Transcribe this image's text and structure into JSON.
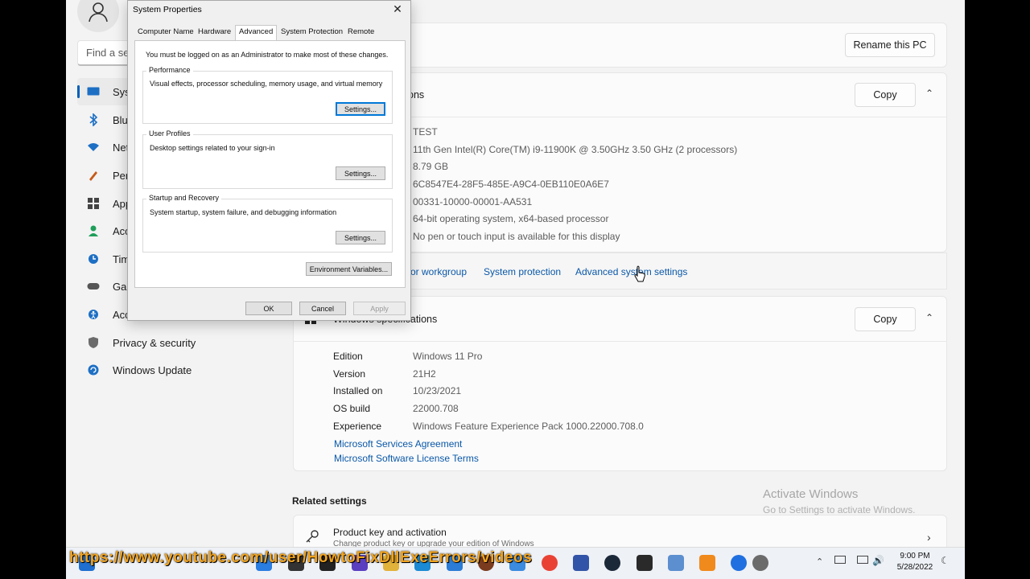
{
  "settings": {
    "search_placeholder": "Find a set",
    "nav": [
      {
        "label": "Syste",
        "icon": "system-icon",
        "active": true
      },
      {
        "label": "Blue",
        "icon": "bluetooth-icon"
      },
      {
        "label": "Netv",
        "icon": "network-icon"
      },
      {
        "label": "Pers",
        "icon": "personalization-icon"
      },
      {
        "label": "App",
        "icon": "apps-icon"
      },
      {
        "label": "Acco",
        "icon": "accounts-icon"
      },
      {
        "label": "Time",
        "icon": "time-icon"
      },
      {
        "label": "Gam",
        "icon": "gaming-icon"
      },
      {
        "label": "Acce",
        "icon": "accessibility-icon"
      },
      {
        "label": "Privacy & security",
        "icon": "shield-icon"
      },
      {
        "label": "Windows Update",
        "icon": "update-icon"
      }
    ],
    "rename_button": "Rename this PC",
    "device_section_title_fragment": "ons",
    "copy_label": "Copy",
    "device_specs": [
      "TEST",
      "11th Gen Intel(R) Core(TM) i9-11900K @ 3.50GHz   3.50 GHz  (2 processors)",
      "8.79 GB",
      "6C8547E4-28F5-485E-A9C4-0EB110E0A6E7",
      "00331-10000-00001-AA531",
      "64-bit operating system, x64-based processor",
      "No pen or touch input is available for this display"
    ],
    "related_links": {
      "domain": "or workgroup",
      "protection": "System protection",
      "advanced": "Advanced system settings"
    },
    "windows_spec_title": "Windows specifications",
    "windows_specs": [
      {
        "key": "Edition",
        "value": "Windows 11 Pro"
      },
      {
        "key": "Version",
        "value": "21H2"
      },
      {
        "key": "Installed on",
        "value": "10/23/2021"
      },
      {
        "key": "OS build",
        "value": "22000.708"
      },
      {
        "key": "Experience",
        "value": "Windows Feature Experience Pack 1000.22000.708.0"
      }
    ],
    "ms_links": [
      "Microsoft Services Agreement",
      "Microsoft Software License Terms"
    ],
    "related_settings_title": "Related settings",
    "product_key_title": "Product key and activation",
    "product_key_sub": "Change product key or upgrade your edition of Windows",
    "activate_title": "Activate Windows",
    "activate_sub": "Go to Settings to activate Windows."
  },
  "dialog": {
    "title": "System Properties",
    "tabs": [
      "Computer Name",
      "Hardware",
      "Advanced",
      "System Protection",
      "Remote"
    ],
    "active_tab": "Advanced",
    "admin_note": "You must be logged on as an Administrator to make most of these changes.",
    "performance_title": "Performance",
    "performance_desc": "Visual effects, processor scheduling, memory usage, and virtual memory",
    "profiles_title": "User Profiles",
    "profiles_desc": "Desktop settings related to your sign-in",
    "startup_title": "Startup and Recovery",
    "startup_desc": "System startup, system failure, and debugging information",
    "settings_label": "Settings...",
    "env_label": "Environment Variables...",
    "ok": "OK",
    "cancel": "Cancel",
    "apply": "Apply"
  },
  "taskbar": {
    "time": "9:00 PM",
    "date": "5/28/2022"
  },
  "watermark": "https://www.youtube.com/user/HowtoFixDllExeErrors/videos",
  "colors": {
    "accent": "#005fb8",
    "link": "#0a58a8",
    "watermark": "#f2a41f"
  }
}
